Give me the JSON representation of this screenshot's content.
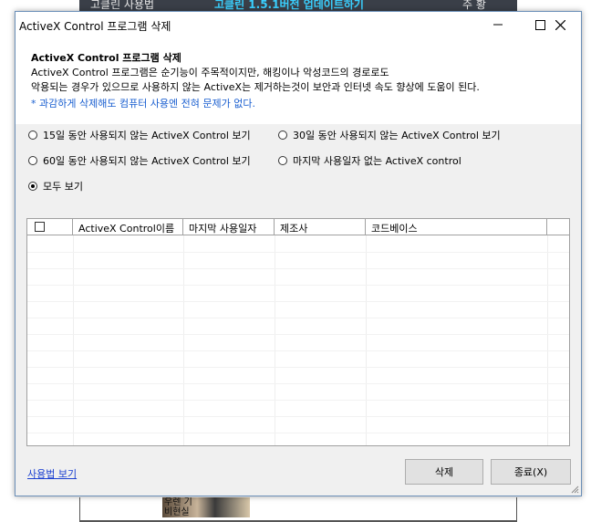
{
  "background": {
    "top_left": "고클린 사용법",
    "top_center": "고클린 1.5.1버전 업데이트하기",
    "top_right": "주 황",
    "thumb_text": "우렌 기\n비현실"
  },
  "window": {
    "title": "ActiveX Control 프로그램 삭제"
  },
  "header": {
    "title": "ActiveX Control 프로그램 삭제",
    "line1": "ActiveX Control 프로그램은 순기능이 주목적이지만, 해킹이나 악성코드의 경로로도",
    "line2": "악용되는 경우가 있으므로 사용하지 않는 ActiveX는 제거하는것이 보안과 인터넷 속도 향상에 도움이 된다.",
    "note": "* 과감하게 삭제해도 컴퓨터 사용엔 전혀 문제가 없다."
  },
  "filters": [
    {
      "label": "15일 동안 사용되지 않는 ActiveX Control 보기",
      "selected": false
    },
    {
      "label": "30일 동안 사용되지 않는 ActiveX Control 보기",
      "selected": false
    },
    {
      "label": "60일 동안 사용되지 않는 ActiveX Control 보기",
      "selected": false
    },
    {
      "label": "마지막 사용일자 없는 ActiveX control",
      "selected": false
    },
    {
      "label": "모두 보기",
      "selected": true
    }
  ],
  "table": {
    "columns": [
      "ActiveX Control이름",
      "마지막 사용일자",
      "제조사",
      "코드베이스"
    ],
    "rows": []
  },
  "footer": {
    "help_link": "사용법 보기",
    "delete_button": "삭제",
    "close_button": "종료(X)"
  }
}
